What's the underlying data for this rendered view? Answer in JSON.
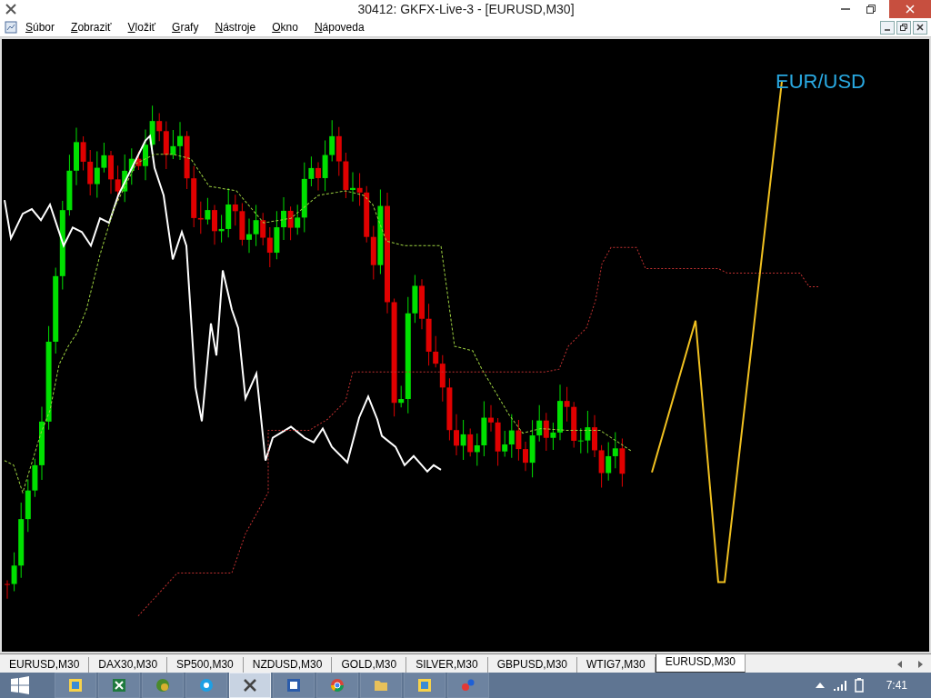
{
  "window": {
    "title": "30412: GKFX-Live-3 - [EURUSD,M30]"
  },
  "menu": [
    "Súbor",
    "Zobraziť",
    "Vložiť",
    "Grafy",
    "Nástroje",
    "Okno",
    "Nápoveda"
  ],
  "chart": {
    "label": "EUR/USD"
  },
  "tabs": [
    {
      "label": "EURUSD,M30",
      "selected": false
    },
    {
      "label": "DAX30,M30",
      "selected": false
    },
    {
      "label": "SP500,M30",
      "selected": false
    },
    {
      "label": "NZDUSD,M30",
      "selected": false
    },
    {
      "label": "GOLD,M30",
      "selected": false
    },
    {
      "label": "SILVER,M30",
      "selected": false
    },
    {
      "label": "GBPUSD,M30",
      "selected": false
    },
    {
      "label": "WTIG7,M30",
      "selected": false
    },
    {
      "label": "EURUSD,M30",
      "selected": true
    }
  ],
  "taskbar": {
    "apps": [
      {
        "kind": "gallery",
        "selected": false
      },
      {
        "kind": "excel",
        "selected": false
      },
      {
        "kind": "globe",
        "selected": false
      },
      {
        "kind": "skype",
        "selected": false
      },
      {
        "kind": "terminal",
        "selected": true
      },
      {
        "kind": "word",
        "selected": false
      },
      {
        "kind": "chrome",
        "selected": false
      },
      {
        "kind": "folder",
        "selected": false
      },
      {
        "kind": "gallery",
        "selected": false
      },
      {
        "kind": "dots",
        "selected": false
      }
    ],
    "clock": "7:41"
  }
}
